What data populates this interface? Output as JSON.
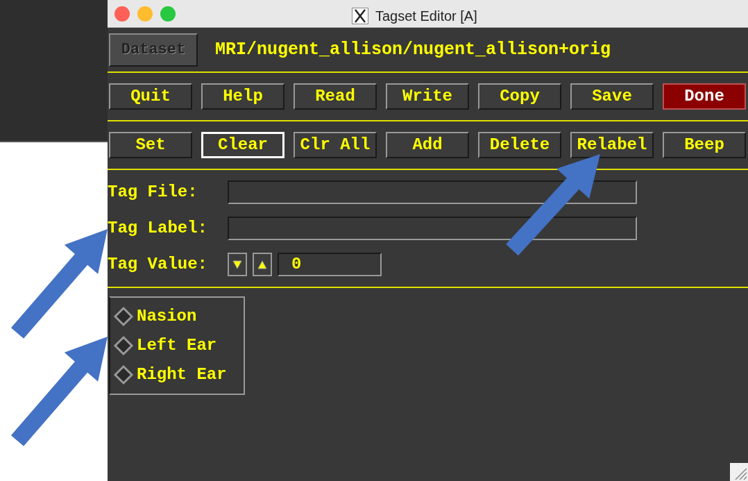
{
  "window": {
    "title": "Tagset Editor [A]"
  },
  "dataset": {
    "button": "Dataset",
    "path": "MRI/nugent_allison/nugent_allison+orig"
  },
  "buttons_row_1": [
    {
      "label": "Quit",
      "kind": "normal"
    },
    {
      "label": "Help",
      "kind": "normal"
    },
    {
      "label": "Read",
      "kind": "normal"
    },
    {
      "label": "Write",
      "kind": "normal"
    },
    {
      "label": "Copy",
      "kind": "normal"
    },
    {
      "label": "Save",
      "kind": "normal"
    },
    {
      "label": "Done",
      "kind": "done"
    }
  ],
  "buttons_row_2": [
    {
      "label": "Set",
      "focused": false
    },
    {
      "label": "Clear",
      "focused": true
    },
    {
      "label": "Clr All",
      "focused": false
    },
    {
      "label": "Add",
      "focused": false
    },
    {
      "label": "Delete",
      "focused": false
    },
    {
      "label": "Relabel",
      "focused": false
    },
    {
      "label": "Beep",
      "focused": false
    }
  ],
  "fields": [
    {
      "label": "Tag File:",
      "kind": "text"
    },
    {
      "label": "Tag Label:",
      "kind": "text"
    },
    {
      "label": "Tag Value:",
      "kind": "spinner",
      "value": "0"
    }
  ],
  "tags": [
    {
      "label": "Nasion",
      "selected": false
    },
    {
      "label": "Left Ear",
      "selected": false
    },
    {
      "label": "Right Ear",
      "selected": false
    }
  ]
}
